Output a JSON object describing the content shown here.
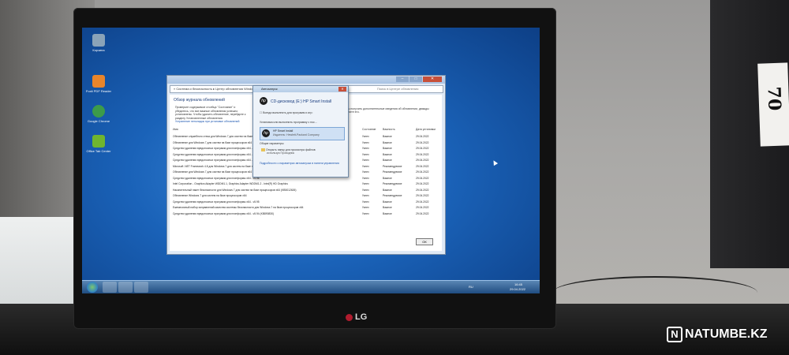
{
  "monitor": {
    "brand": "LG"
  },
  "sticker": {
    "text": "70"
  },
  "watermark": {
    "mark": "N",
    "text": "NATUMBE.KZ"
  },
  "desktop_icons": [
    {
      "label": "Корзина",
      "color": "#8aa3b8"
    },
    {
      "label": "Foxit PDF Reader",
      "color": "#e8852b"
    },
    {
      "label": "Google Chrome",
      "color": "#3c9b4a"
    },
    {
      "label": "Office Tab Center",
      "color": "#6fb52f"
    }
  ],
  "update_window": {
    "breadcrumb": "« Система и безопасность ▸ Центр обновления Windows ▸",
    "search_placeholder": "Поиск в Центре обновления",
    "title": "Обзор журнала обновлений",
    "description": "Проверьте содержимое столбца \"Состояние\" и убедитесь, что все важные обновления успешно установлены. Чтобы удалить обновление, перейдите к разделу Установленные обновления.",
    "troubleshoot_link": "Устранение неполадок при установке обновлений",
    "right_note": "Чтобы получить дополнительные сведения об обновлении, дважды щелкните его.",
    "columns": {
      "name": "Имя",
      "status": "Состояние",
      "importance": "Важность",
      "date": "Дата установки"
    },
    "rows": [
      {
        "name": "Обновление служебного стека для Windows 7 для систем на базе процессоров x64",
        "status": "Успех",
        "importance": "Важное",
        "date": "29.04.2022"
      },
      {
        "name": "Обновление для Windows 7 для систем на базе процессоров x64",
        "status": "Успех",
        "importance": "Важное",
        "date": "29.04.2022"
      },
      {
        "name": "Средство удаления вредоносных программ для платформы x64 - v5.99",
        "status": "Успех",
        "importance": "Важное",
        "date": "29.04.2022"
      },
      {
        "name": "Средство удаления вредоносных программ для платформы x64 - v5.98",
        "status": "Успех",
        "importance": "Важное",
        "date": "29.04.2022"
      },
      {
        "name": "Средство удаления вредоносных программ для платформы x64 - v5.97",
        "status": "Успех",
        "importance": "Важное",
        "date": "29.04.2022"
      },
      {
        "name": "Microsoft .NET Framework 4.8 для Windows 7 для систем на базе процессоров x64",
        "status": "Успех",
        "importance": "Рекомендуемое",
        "date": "29.04.2022"
      },
      {
        "name": "Обновление для Windows 7 для систем на базе процессоров x64",
        "status": "Успех",
        "importance": "Рекомендуемое",
        "date": "29.04.2022"
      },
      {
        "name": "Средство удаления вредоносных программ для платформы x64 - v5.96",
        "status": "Успех",
        "importance": "Важное",
        "date": "29.04.2022"
      },
      {
        "name": "Intel Corporation - Graphics Adapter WDDM1.1, Graphics Adapter WDDM1.2 - Intel(R) HD Graphics",
        "status": "Успех",
        "importance": "Рекомендуемое",
        "date": "29.04.2022"
      },
      {
        "name": "Накопительный пакет безопасности для Windows 7 для систем на базе процессоров x64 (KB5012626)",
        "status": "Успех",
        "importance": "Важное",
        "date": "29.04.2022"
      },
      {
        "name": "Обновление Windows 7 для систем на базе процессоров x64",
        "status": "Успех",
        "importance": "Рекомендуемое",
        "date": "29.04.2022"
      },
      {
        "name": "Средство удаления вредоносных программ для платформы x64 - v5.95",
        "status": "Успех",
        "importance": "Важное",
        "date": "29.04.2022"
      },
      {
        "name": "Ежемесячный набор исправлений качества системы безопасности для Windows 7 на базе процессоров x64",
        "status": "Успех",
        "importance": "Важное",
        "date": "29.04.2022"
      },
      {
        "name": "Средство удаления вредоносных программ для платформы x64 - v5.94 (KB890830)",
        "status": "Успех",
        "importance": "Важное",
        "date": "29.04.2022"
      }
    ],
    "ok_label": "ОК"
  },
  "autoplay": {
    "title": "Автозапуск",
    "drive": "CD-дисковод (E:) HP Smart Install",
    "always_do": "Всегда выполнять для программ и игр:",
    "install_heading": "Установка или выполнить программу с нос...",
    "option_name": "HP Smart Install",
    "option_publisher": "Издатель: Hewlett-Packard Company",
    "general_heading": "Общие параметры",
    "open_folder": "Открыть папку для просмотра файлов",
    "open_folder_sub": "используя Проводник",
    "more_link": "Подробности о параметрах автозапуска в панели управления"
  },
  "taskbar": {
    "lang": "RU",
    "time": "16:45",
    "date": "29.04.2022"
  }
}
